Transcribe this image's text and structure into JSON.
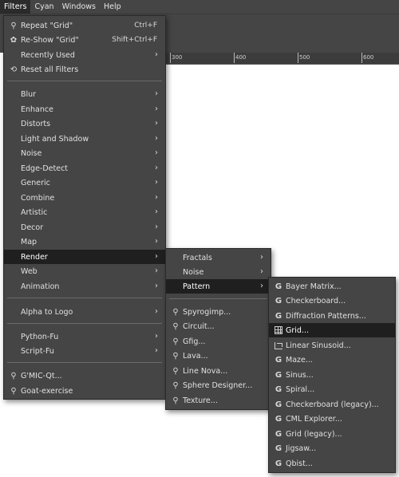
{
  "menubar": {
    "items": [
      "Filters",
      "Cyan",
      "Windows",
      "Help"
    ]
  },
  "ruler": {
    "ticks": [
      "300",
      "400",
      "500",
      "600"
    ]
  },
  "filters_menu": {
    "items": [
      {
        "label": "Repeat \"Grid\"",
        "shortcut": "Ctrl+F",
        "icon": "repeat-icon"
      },
      {
        "label": "Re-Show \"Grid\"",
        "shortcut": "Shift+Ctrl+F",
        "icon": "reshow-icon"
      },
      {
        "label": "Recently Used",
        "submenu": true
      },
      {
        "label": "Reset all Filters",
        "icon": "reset-icon"
      },
      {
        "label": "Blur",
        "submenu": true
      },
      {
        "label": "Enhance",
        "submenu": true
      },
      {
        "label": "Distorts",
        "submenu": true
      },
      {
        "label": "Light and Shadow",
        "submenu": true
      },
      {
        "label": "Noise",
        "submenu": true
      },
      {
        "label": "Edge-Detect",
        "submenu": true
      },
      {
        "label": "Generic",
        "submenu": true
      },
      {
        "label": "Combine",
        "submenu": true
      },
      {
        "label": "Artistic",
        "submenu": true
      },
      {
        "label": "Decor",
        "submenu": true
      },
      {
        "label": "Map",
        "submenu": true
      },
      {
        "label": "Render",
        "submenu": true,
        "highlighted": true
      },
      {
        "label": "Web",
        "submenu": true
      },
      {
        "label": "Animation",
        "submenu": true
      },
      {
        "label": "Alpha to Logo",
        "submenu": true
      },
      {
        "label": "Python-Fu",
        "submenu": true
      },
      {
        "label": "Script-Fu",
        "submenu": true
      },
      {
        "label": "G'MIC-Qt...",
        "icon": "gmic-icon"
      },
      {
        "label": "Goat-exercise",
        "icon": "goat-icon"
      }
    ]
  },
  "render_menu": {
    "items": [
      {
        "label": "Fractals",
        "submenu": true
      },
      {
        "label": "Noise",
        "submenu": true
      },
      {
        "label": "Pattern",
        "submenu": true,
        "highlighted": true
      },
      {
        "label": "Spyrogimp...",
        "icon": "plugin-icon"
      },
      {
        "label": "Circuit...",
        "icon": "plugin-icon"
      },
      {
        "label": "Gfig...",
        "icon": "plugin-icon"
      },
      {
        "label": "Lava...",
        "icon": "plugin-icon"
      },
      {
        "label": "Line Nova...",
        "icon": "plugin-icon"
      },
      {
        "label": "Sphere Designer...",
        "icon": "plugin-icon"
      },
      {
        "label": "Texture...",
        "icon": "plugin-icon"
      }
    ]
  },
  "pattern_menu": {
    "items": [
      {
        "label": "Bayer Matrix...",
        "icon": "gegl-icon"
      },
      {
        "label": "Checkerboard...",
        "icon": "gegl-icon"
      },
      {
        "label": "Diffraction Patterns...",
        "icon": "gegl-icon"
      },
      {
        "label": "Grid...",
        "icon": "grid-icon",
        "highlighted": true
      },
      {
        "label": "Linear Sinusoid...",
        "icon": "sinusoid-icon"
      },
      {
        "label": "Maze...",
        "icon": "gegl-icon"
      },
      {
        "label": "Sinus...",
        "icon": "gegl-icon"
      },
      {
        "label": "Spiral...",
        "icon": "gegl-icon"
      },
      {
        "label": "Checkerboard (legacy)...",
        "icon": "gegl-icon"
      },
      {
        "label": "CML Explorer...",
        "icon": "gegl-icon"
      },
      {
        "label": "Grid (legacy)...",
        "icon": "gegl-icon"
      },
      {
        "label": "Jigsaw...",
        "icon": "gegl-icon"
      },
      {
        "label": "Qbist...",
        "icon": "gegl-icon"
      }
    ]
  },
  "glyphs": {
    "arrow": "›",
    "plugin": "⚲",
    "gegl": "G",
    "repeat": "⟳"
  }
}
